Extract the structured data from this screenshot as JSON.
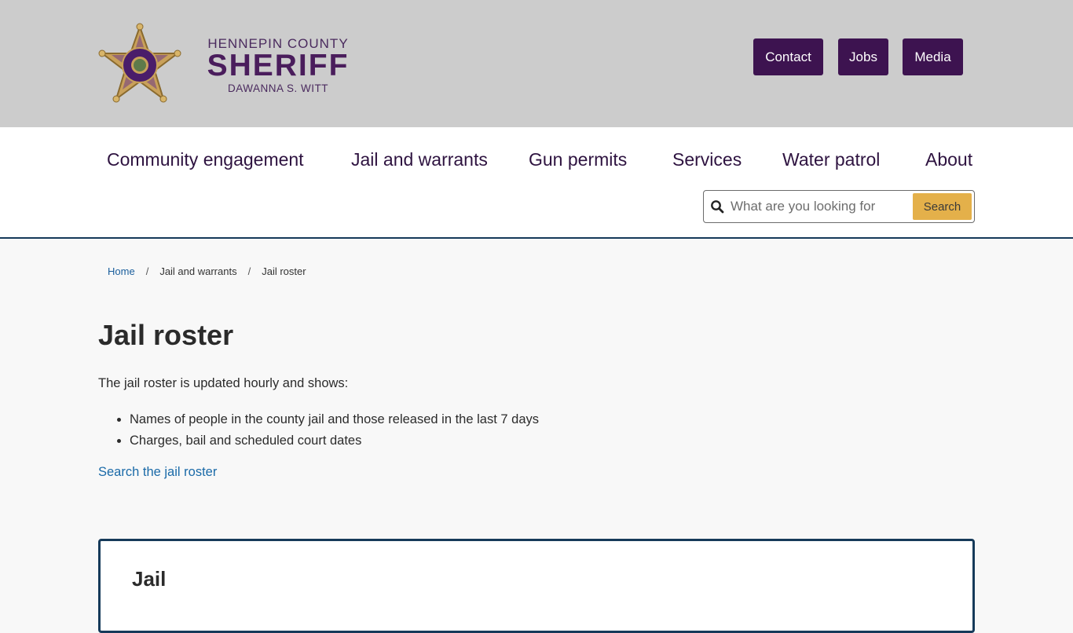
{
  "header": {
    "logo": {
      "line1": "HENNEPIN COUNTY",
      "line2": "SHERIFF",
      "line3": "DAWANNA S. WITT",
      "badge_icon": "sheriff-star-badge-icon"
    },
    "utility_links": [
      {
        "label": "Contact"
      },
      {
        "label": "Jobs"
      },
      {
        "label": "Media"
      }
    ]
  },
  "nav": {
    "items": [
      {
        "label": "Community engagement"
      },
      {
        "label": "Jail and warrants"
      },
      {
        "label": "Gun permits"
      },
      {
        "label": "Services"
      },
      {
        "label": "Water patrol"
      },
      {
        "label": "About"
      }
    ],
    "search": {
      "placeholder": "What are you looking for",
      "value": "",
      "button_label": "Search",
      "icon": "search-icon"
    }
  },
  "breadcrumb": [
    {
      "label": "Home",
      "link": true
    },
    {
      "label": "Jail and warrants",
      "link": false
    },
    {
      "label": "Jail roster",
      "link": false
    }
  ],
  "breadcrumb_separator": "/",
  "main": {
    "title": "Jail roster",
    "intro": "The jail roster is updated hourly and shows:",
    "bullets": [
      "Names of people in the county jail and those released in the last 7 days",
      "Charges, bail and scheduled court dates"
    ],
    "link_label": "Search the jail roster",
    "card": {
      "title": "Jail"
    }
  },
  "colors": {
    "brand_purple": "#3d1350",
    "accent_gold": "#e4b04a",
    "link_blue": "#1a6aa8",
    "border_navy": "#163a5a",
    "header_gray": "#cccccc"
  }
}
